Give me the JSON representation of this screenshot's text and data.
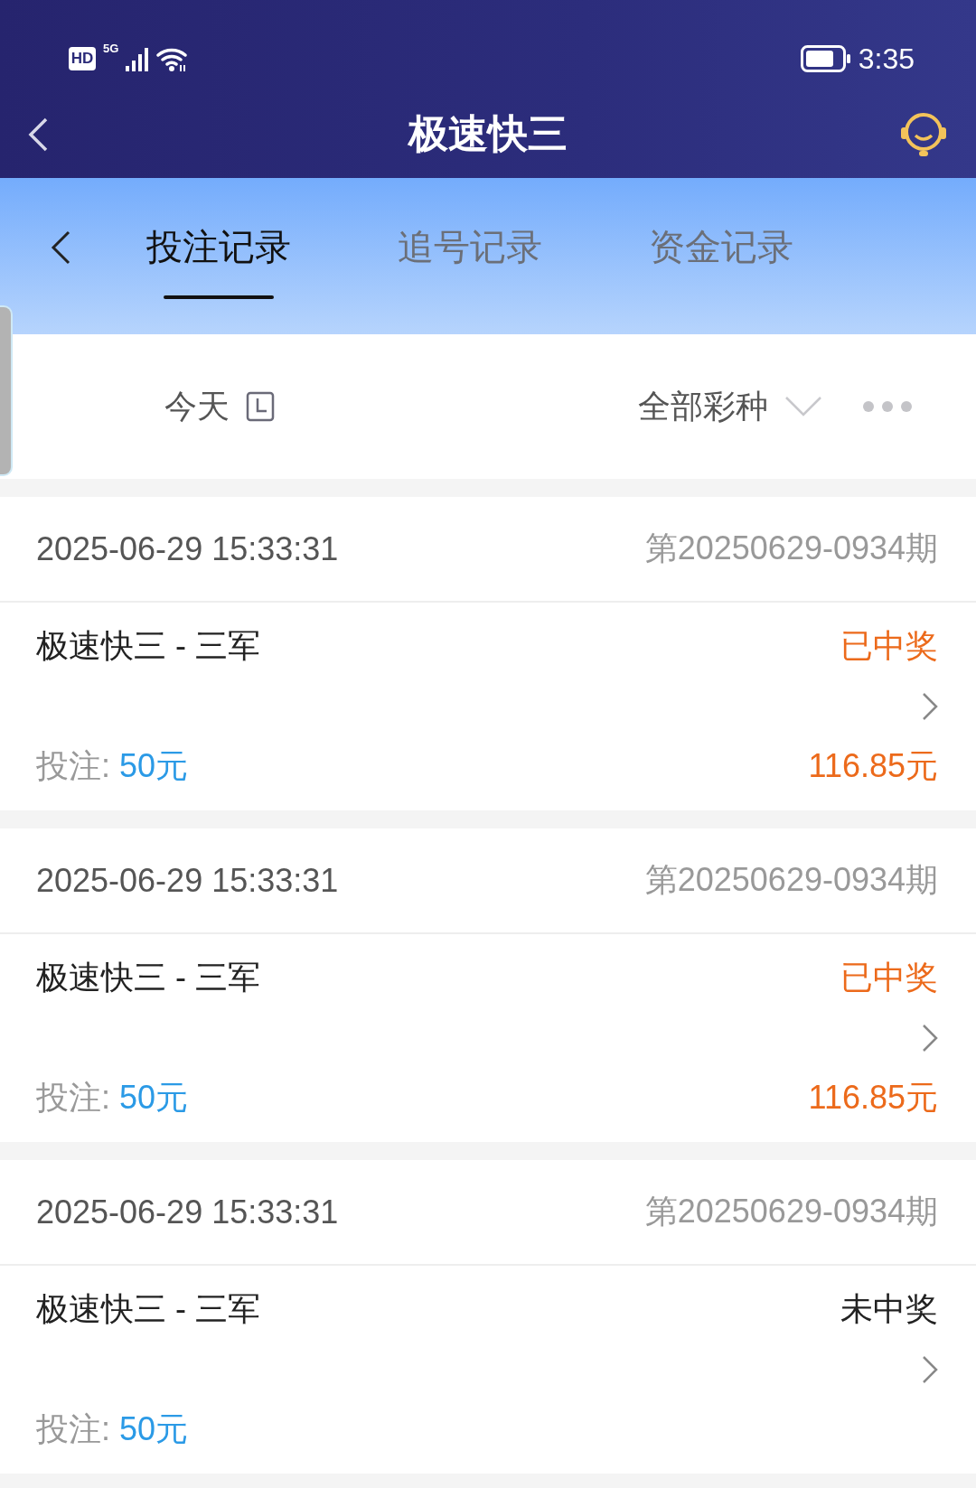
{
  "status_bar": {
    "hd": "HD",
    "network": "5G",
    "time": "3:35"
  },
  "header": {
    "title": "极速快三"
  },
  "tabs": [
    {
      "label": "投注记录",
      "selected": true
    },
    {
      "label": "追号记录",
      "selected": false
    },
    {
      "label": "资金记录",
      "selected": false
    }
  ],
  "filters": {
    "date": "今天",
    "lottery": "全部彩种"
  },
  "records": [
    {
      "time": "2025-06-29 15:33:31",
      "issue": "第20250629-0934期",
      "game": "极速快三 - 三军",
      "status": "已中奖",
      "won": true,
      "bet_label": "投注:",
      "bet_amount": "50元",
      "payout": "116.85元"
    },
    {
      "time": "2025-06-29 15:33:31",
      "issue": "第20250629-0934期",
      "game": "极速快三 - 三军",
      "status": "已中奖",
      "won": true,
      "bet_label": "投注:",
      "bet_amount": "50元",
      "payout": "116.85元"
    },
    {
      "time": "2025-06-29 15:33:31",
      "issue": "第20250629-0934期",
      "game": "极速快三 - 三军",
      "status": "未中奖",
      "won": false,
      "bet_label": "投注:",
      "bet_amount": "50元"
    }
  ]
}
